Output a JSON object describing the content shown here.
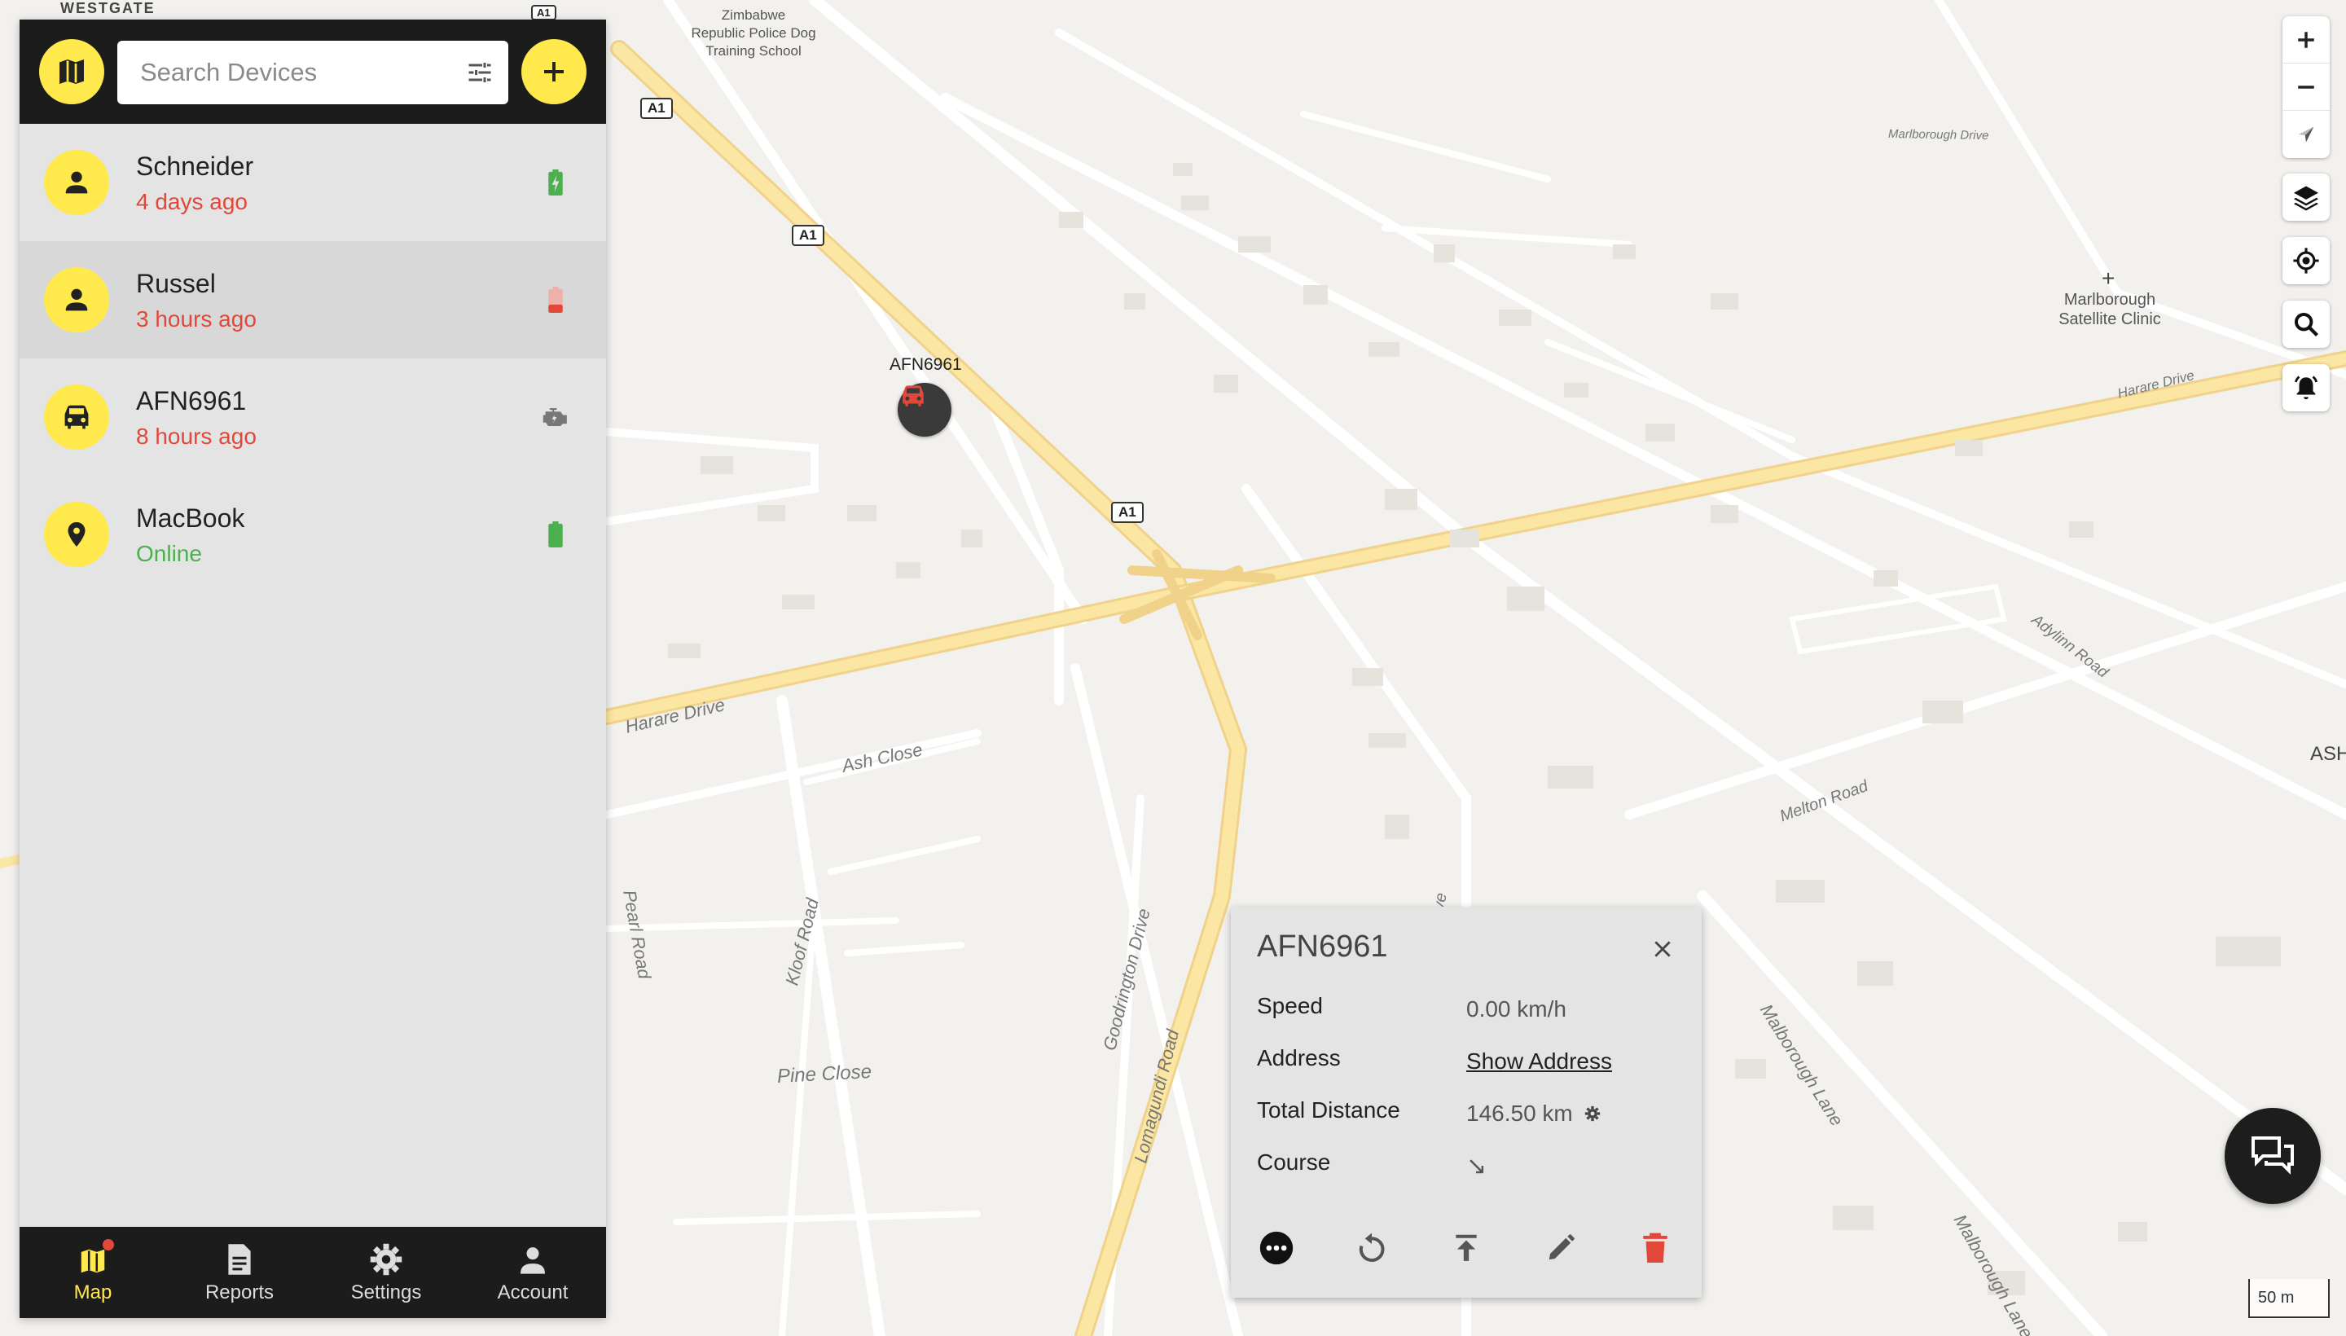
{
  "map": {
    "pois": [
      {
        "text": "Zimbabwe\nRepublic Police Dog\nTraining School"
      },
      {
        "text": "Marlborough\nSatellite Clinic"
      }
    ],
    "area_labels": [
      "WESTGATE",
      "ASH"
    ],
    "road_names": [
      "Harare Drive",
      "Ash Close",
      "Pearl Road",
      "Kloof Road",
      "Pine Close",
      "Goodrington Drive",
      "Lomagundi Road",
      "Adylinn Road",
      "Melton Road",
      "Malborough Lane",
      "Malborough Lane",
      "Harare Drive",
      "Marlborough Drive",
      "ive"
    ],
    "shields": [
      "A1",
      "A1",
      "A1",
      "A1"
    ],
    "marker": {
      "label": "AFN6961",
      "icon": "car-icon",
      "color": "#e2483a"
    },
    "scale": "50 m"
  },
  "sidebar": {
    "map_toggle_icon": "map-icon",
    "search": {
      "placeholder": "Search Devices",
      "value": ""
    },
    "filter_icon": "tune-icon",
    "add_icon": "plus-icon",
    "devices": [
      {
        "name": "Schneider",
        "status": "4 days ago",
        "status_color": "#e2483a",
        "icon": "person-icon",
        "indicator": "battery-charging-icon",
        "indicator_color": "#4caf50"
      },
      {
        "name": "Russel",
        "status": "3 hours ago",
        "status_color": "#e2483a",
        "icon": "person-icon",
        "indicator": "battery-low-icon",
        "indicator_color": "#e2483a",
        "selected": true
      },
      {
        "name": "AFN6961",
        "status": "8 hours ago",
        "status_color": "#e2483a",
        "icon": "car-icon",
        "indicator": "engine-icon",
        "indicator_color": "#777777"
      },
      {
        "name": "MacBook",
        "status": "Online",
        "status_color": "#4caf50",
        "icon": "location-pin-icon",
        "indicator": "battery-full-icon",
        "indicator_color": "#4caf50"
      }
    ],
    "nav": [
      {
        "label": "Map",
        "icon": "map-icon",
        "active": true,
        "badge": true
      },
      {
        "label": "Reports",
        "icon": "report-icon"
      },
      {
        "label": "Settings",
        "icon": "gear-icon"
      },
      {
        "label": "Account",
        "icon": "person-icon"
      }
    ]
  },
  "map_controls": [
    "zoom-in-icon",
    "zoom-out-icon",
    "compass-icon",
    "layers-icon",
    "my-location-icon",
    "search-icon",
    "notifications-icon"
  ],
  "popup": {
    "title": "AFN6961",
    "rows": [
      {
        "label": "Speed",
        "value": "0.00 km/h"
      },
      {
        "label": "Address",
        "value": "Show Address",
        "link": true
      },
      {
        "label": "Total Distance",
        "value": "146.50 km",
        "extra_icon": "gear-icon"
      },
      {
        "label": "Course",
        "value": "↘"
      }
    ],
    "actions": [
      "more-icon",
      "replay-icon",
      "upload-icon",
      "edit-icon",
      "delete-icon"
    ],
    "accent_danger": "#e2483a"
  },
  "chat_icon": "chat-icon",
  "accent": "#ffe94d"
}
